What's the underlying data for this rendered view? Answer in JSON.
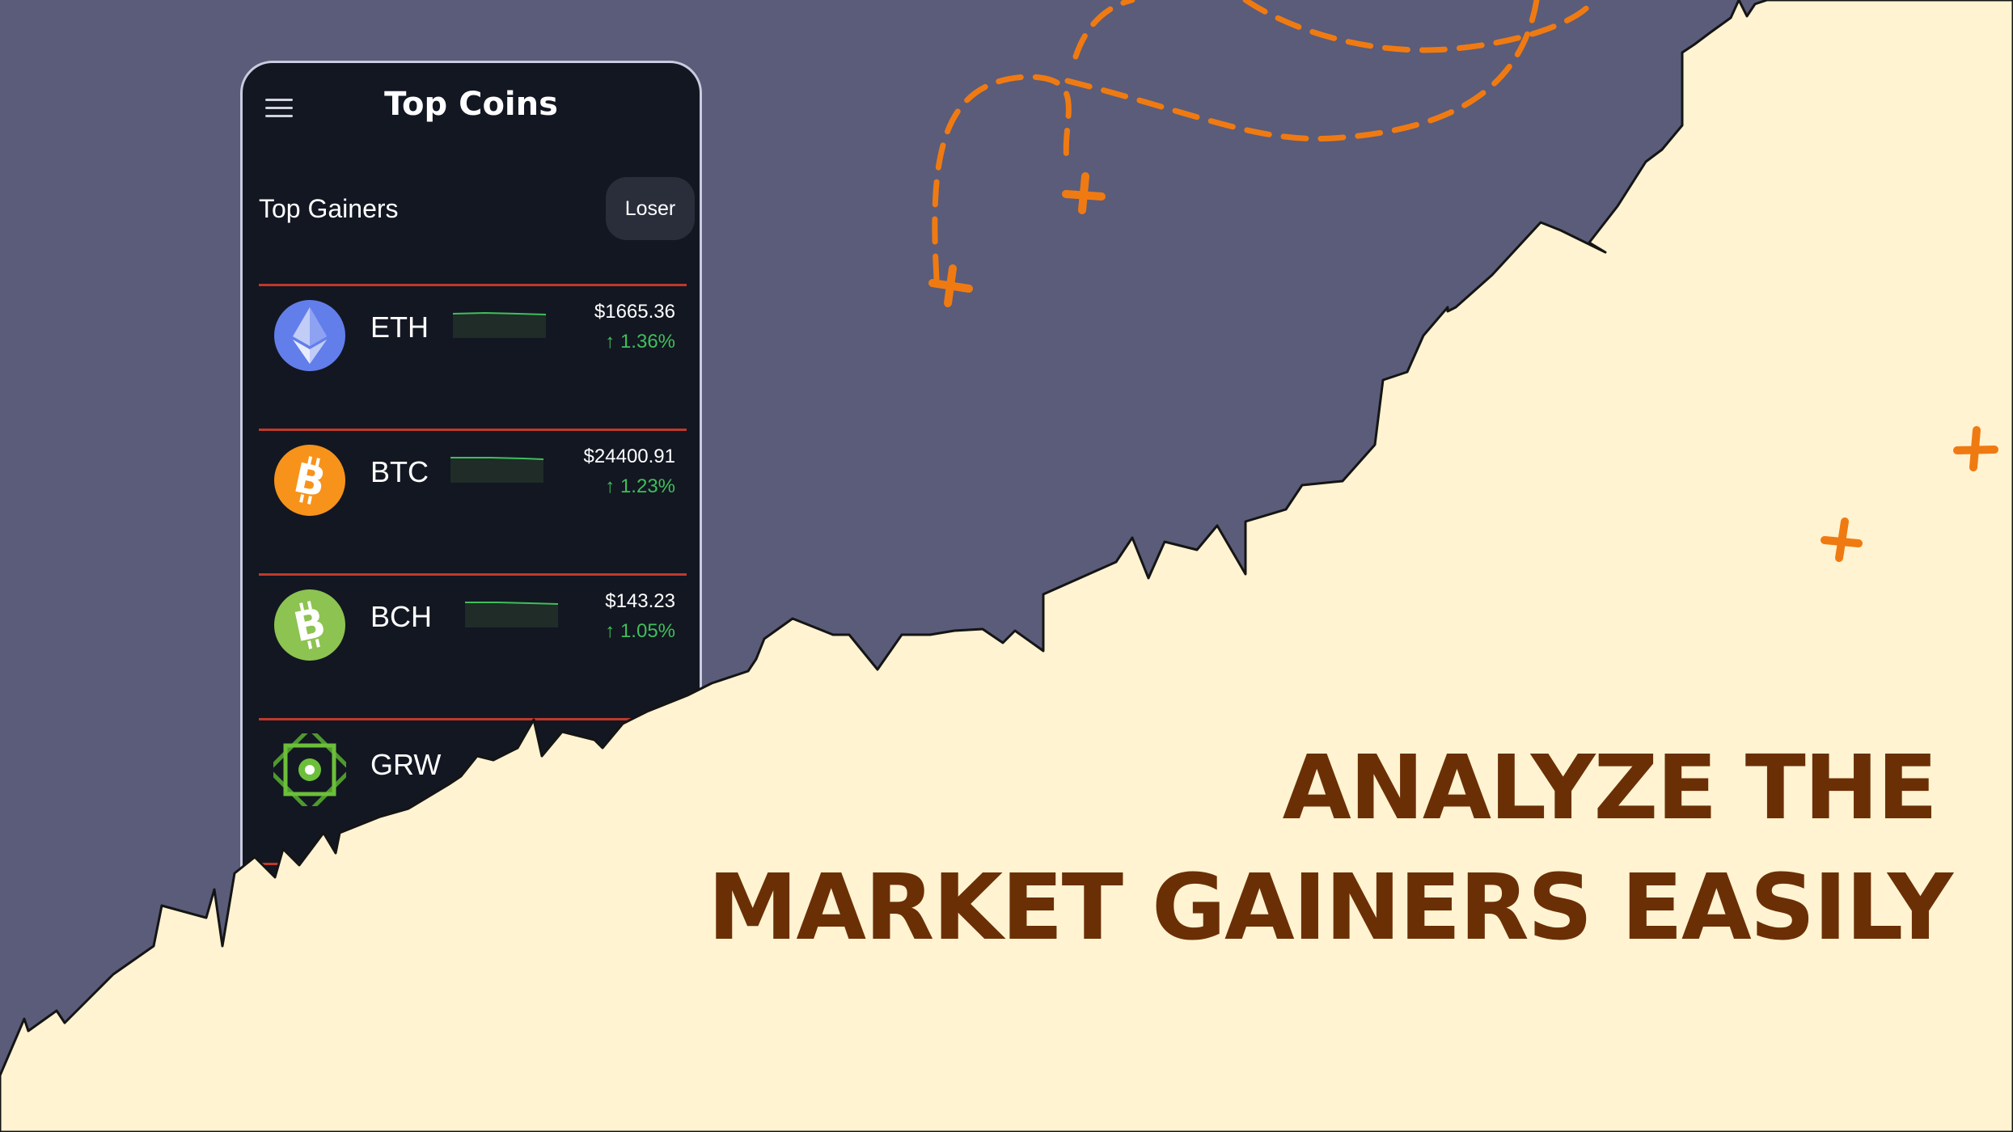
{
  "app": {
    "title": "Top Coins",
    "tab_active": "Top Gainers",
    "tab_other": "Loser"
  },
  "coins": [
    {
      "symbol": "ETH",
      "price": "$1665.36",
      "change": "↑ 1.36%",
      "icon": "ethereum-icon",
      "color": "#627eea"
    },
    {
      "symbol": "BTC",
      "price": "$24400.91",
      "change": "↑ 1.23%",
      "icon": "bitcoin-icon",
      "color": "#f7931a"
    },
    {
      "symbol": "BCH",
      "price": "$143.23",
      "change": "↑ 1.05%",
      "icon": "bitcoin-cash-icon",
      "color": "#8dc351"
    },
    {
      "symbol": "GRW",
      "price": "",
      "change": "",
      "icon": "growth-icon",
      "color": "#4e9a2c"
    }
  ],
  "headline": {
    "line1": "ANALYZE THE",
    "line2": "MARKET GAINERS EASILY"
  },
  "colors": {
    "background_dark": "#5a5c79",
    "background_light": "#fff3d1",
    "accent_orange": "#f07a12",
    "headline": "#6b2f06",
    "positive_change": "#3fbf5a",
    "row_divider": "#c0392b"
  }
}
